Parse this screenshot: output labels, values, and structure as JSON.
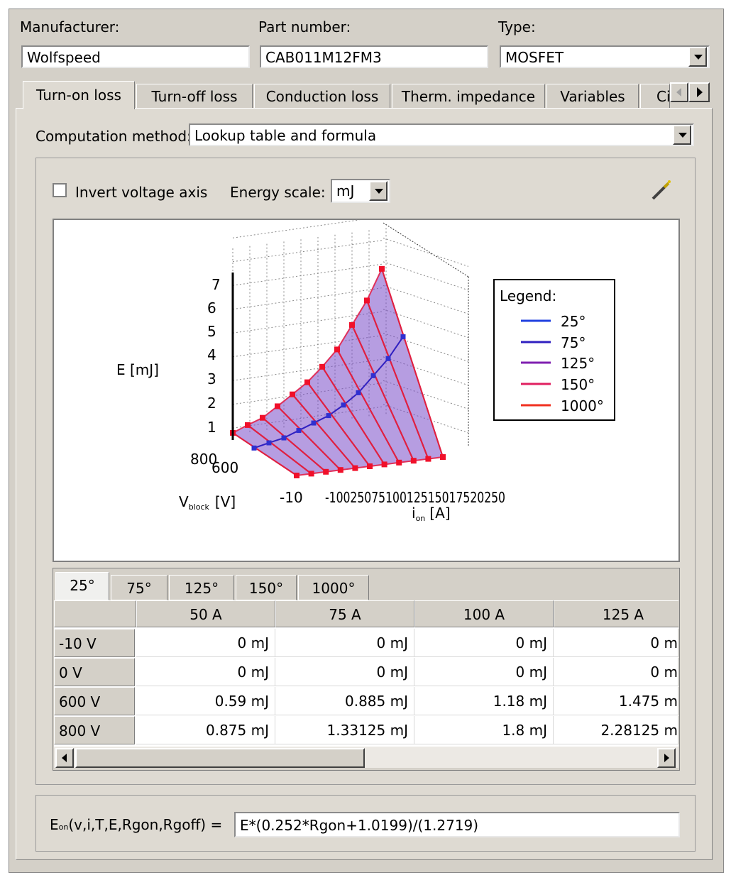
{
  "header": {
    "manufacturer_label": "Manufacturer:",
    "manufacturer_value": "Wolfspeed",
    "part_label": "Part number:",
    "part_value": "CAB011M12FM3",
    "type_label": "Type:",
    "type_value": "MOSFET"
  },
  "tabs": [
    "Turn-on loss",
    "Turn-off loss",
    "Conduction loss",
    "Therm. impedance",
    "Variables",
    "Ci"
  ],
  "computation": {
    "label": "Computation method:",
    "value": "Lookup table and formula"
  },
  "options": {
    "invert_label": "Invert voltage axis",
    "invert_checked": false,
    "energy_scale_label": "Energy scale:",
    "energy_scale_value": "mJ"
  },
  "chart_data": {
    "type": "surface3d",
    "zlabel": "E [mJ]",
    "z_ticks": [
      "1",
      "2",
      "3",
      "4",
      "5",
      "6",
      "7"
    ],
    "v_label_main": "V",
    "v_label_sub": "block",
    "v_label_unit": "[V]",
    "v_ticks": [
      "800",
      "600",
      "-10"
    ],
    "i_label_main": "i",
    "i_label_sub": "on",
    "i_label_unit": "[A]",
    "i_ticks": "-1002507510012515017520250",
    "legend_title": "Legend:",
    "series": [
      {
        "name": "25°",
        "color": "#2040e0"
      },
      {
        "name": "75°",
        "color": "#3020c0"
      },
      {
        "name": "125°",
        "color": "#8020b0"
      },
      {
        "name": "150°",
        "color": "#e02060"
      },
      {
        "name": "1000°",
        "color": "#f03020"
      }
    ],
    "voltages": [
      -10,
      0,
      600,
      800
    ],
    "currents": [
      0,
      25,
      50,
      75,
      100,
      125,
      150,
      175,
      200,
      225,
      250
    ],
    "energy_at_800V": [
      0.3,
      0.6,
      0.875,
      1.33,
      1.8,
      2.28,
      2.9,
      3.6,
      4.6,
      5.6,
      6.9
    ],
    "energy_at_600V": [
      0.2,
      0.4,
      0.59,
      0.885,
      1.18,
      1.475,
      1.9,
      2.4,
      3.1,
      3.8,
      4.7
    ]
  },
  "table": {
    "tabs": [
      "25°",
      "75°",
      "125°",
      "150°",
      "1000°"
    ],
    "columns": [
      "50 A",
      "75 A",
      "100 A",
      "125 A"
    ],
    "rows": [
      {
        "label": "-10 V",
        "values": [
          "0 mJ",
          "0 mJ",
          "0 mJ",
          "0 m"
        ]
      },
      {
        "label": "0 V",
        "values": [
          "0 mJ",
          "0 mJ",
          "0 mJ",
          "0 m"
        ]
      },
      {
        "label": "600 V",
        "values": [
          "0.59 mJ",
          "0.885 mJ",
          "1.18 mJ",
          "1.475 m"
        ]
      },
      {
        "label": "800 V",
        "values": [
          "0.875 mJ",
          "1.33125 mJ",
          "1.8 mJ",
          "2.28125 m"
        ]
      }
    ]
  },
  "formula": {
    "label_main": "E",
    "label_sub": "on",
    "label_rest": "(v,i,T,E,Rgon,Rgoff) =",
    "value": "E*(0.252*Rgon+1.0199)/(1.2719)"
  }
}
